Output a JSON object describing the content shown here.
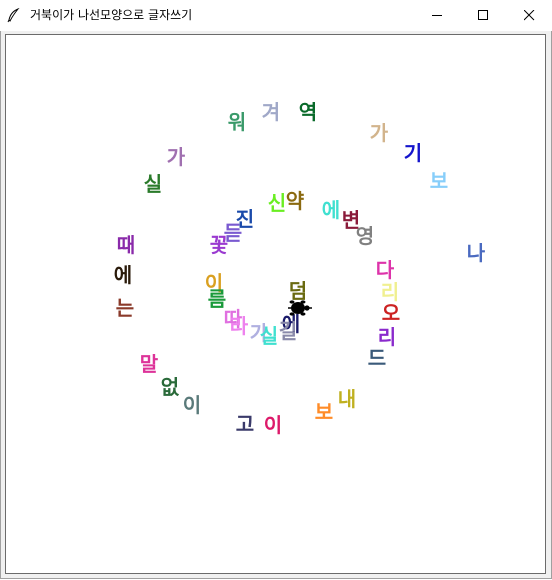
{
  "window": {
    "title": "거북이가 나선모양으로 글자쓰기",
    "icons": {
      "app": "feather-icon",
      "minimize": "minimize-icon",
      "maximize": "maximize-icon",
      "close": "close-icon"
    }
  },
  "canvas": {
    "turtle_icon": "turtle-icon",
    "glyphs": [
      {
        "text": "워",
        "color": "#3a9a6a"
      },
      {
        "text": "겨",
        "color": "#a0a8c8"
      },
      {
        "text": "역",
        "color": "#0a6a2a"
      },
      {
        "text": "가",
        "color": "#d2b48c"
      },
      {
        "text": "기",
        "color": "#1414cc"
      },
      {
        "text": "보",
        "color": "#87cefa"
      },
      {
        "text": "가",
        "color": "#a070b0"
      },
      {
        "text": "실",
        "color": "#2a7a2a"
      },
      {
        "text": "진",
        "color": "#1a4aaa"
      },
      {
        "text": "신",
        "color": "#6aee22"
      },
      {
        "text": "약",
        "color": "#8b6a10"
      },
      {
        "text": "에",
        "color": "#40e0d0"
      },
      {
        "text": "변",
        "color": "#8a1a3a"
      },
      {
        "text": "영",
        "color": "#808080"
      },
      {
        "text": "나",
        "color": "#4a6ac0"
      },
      {
        "text": "듣",
        "color": "#7a5ad0"
      },
      {
        "text": "때",
        "color": "#8a2aaa"
      },
      {
        "text": "꽃",
        "color": "#9a3ad0"
      },
      {
        "text": "다",
        "color": "#dd33aa"
      },
      {
        "text": "리",
        "color": "#f0f090"
      },
      {
        "text": "에",
        "color": "#2a1a0a"
      },
      {
        "text": "이",
        "color": "#daa020"
      },
      {
        "text": "덤",
        "color": "#6a6a10"
      },
      {
        "text": "름",
        "color": "#1a9a3a"
      },
      {
        "text": "는",
        "color": "#8a3a2a"
      },
      {
        "text": "오",
        "color": "#cc2222"
      },
      {
        "text": "리",
        "color": "#8a2acc"
      },
      {
        "text": "따",
        "color": "#e070e0"
      },
      {
        "text": "라",
        "color": "#ee82ee"
      },
      {
        "text": "에",
        "color": "#1a1a6a"
      },
      {
        "text": "길",
        "color": "#8a8aaa"
      },
      {
        "text": "가",
        "color": "#b0b0e0"
      },
      {
        "text": "실",
        "color": "#40e0d0"
      },
      {
        "text": "드",
        "color": "#3a5a7a"
      },
      {
        "text": "말",
        "color": "#dd3399"
      },
      {
        "text": "없",
        "color": "#2a6a3a"
      },
      {
        "text": "이",
        "color": "#5a7a7a"
      },
      {
        "text": "내",
        "color": "#c0b020"
      },
      {
        "text": "보",
        "color": "#ff8c28"
      },
      {
        "text": "고",
        "color": "#3a3a6a"
      },
      {
        "text": "이",
        "color": "#dd1a6a"
      }
    ]
  }
}
